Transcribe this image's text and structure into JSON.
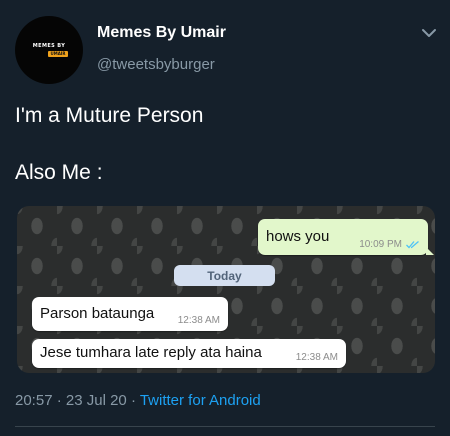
{
  "author": {
    "display_name": "Memes By Umair",
    "handle": "@tweetsbyburger",
    "avatar_text": "MEMES BY",
    "avatar_badge": "UMAIR"
  },
  "tweet": {
    "line1": "I'm a Muture Person",
    "line2": "Also Me :"
  },
  "chat": {
    "outgoing": {
      "text": "hows you",
      "time": "10:09 PM"
    },
    "date_chip": "Today",
    "incoming": [
      {
        "text": "Parson bataunga",
        "time": "12:38 AM"
      },
      {
        "text": "Jese tumhara late reply ata haina",
        "time": "12:38 AM"
      }
    ]
  },
  "meta": {
    "time": "20:57",
    "separator1": " · ",
    "date": "23 Jul 20",
    "separator2": " · ",
    "source": "Twitter for Android"
  },
  "colors": {
    "background": "#15202b",
    "secondary_text": "#8899a6",
    "link": "#1da1f2",
    "outgoing_bubble": "#e2f7cb",
    "read_ticks": "#4fc3f7"
  },
  "icons": {
    "menu": "chevron-down-icon",
    "read_receipt": "double-check-icon"
  }
}
